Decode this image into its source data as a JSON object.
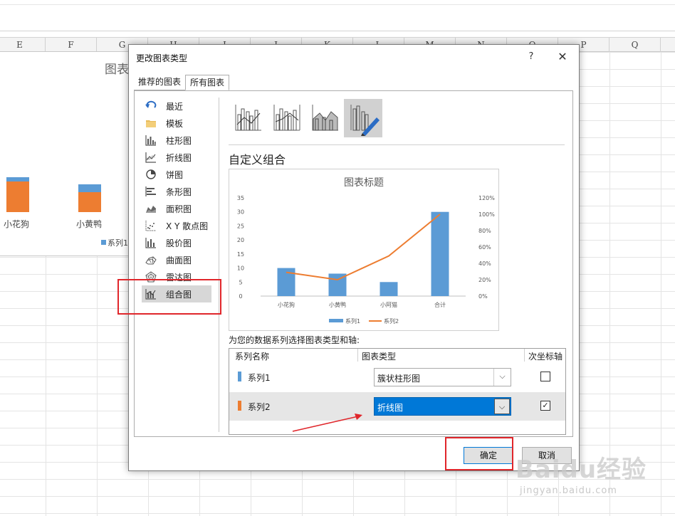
{
  "sheet": {
    "columns": [
      "E",
      "F",
      "G",
      "H",
      "I",
      "J",
      "K",
      "L",
      "M",
      "N",
      "O",
      "P",
      "Q"
    ],
    "chart": {
      "title": "图表",
      "categories": [
        "小花狗",
        "小黄鸭"
      ],
      "legend": "系列1"
    }
  },
  "dialog": {
    "title": "更改图表类型",
    "help": "?",
    "close": "✕",
    "tabs": [
      {
        "label": "推荐的图表"
      },
      {
        "label": "所有图表"
      }
    ],
    "chart_types": [
      {
        "label": "最近",
        "icon": "undo-icon"
      },
      {
        "label": "模板",
        "icon": "folder-icon"
      },
      {
        "label": "柱形图",
        "icon": "column-chart-icon"
      },
      {
        "label": "折线图",
        "icon": "line-chart-icon"
      },
      {
        "label": "饼图",
        "icon": "pie-chart-icon"
      },
      {
        "label": "条形图",
        "icon": "bar-chart-icon"
      },
      {
        "label": "面积图",
        "icon": "area-chart-icon"
      },
      {
        "label": "X Y 散点图",
        "icon": "scatter-chart-icon"
      },
      {
        "label": "股价图",
        "icon": "stock-chart-icon"
      },
      {
        "label": "曲面图",
        "icon": "surface-chart-icon"
      },
      {
        "label": "雷达图",
        "icon": "radar-chart-icon"
      },
      {
        "label": "组合图",
        "icon": "combo-chart-icon"
      }
    ],
    "selected_type": "组合图",
    "section_title": "自定义组合",
    "series_prompt": "为您的数据系列选择图表类型和轴:",
    "table": {
      "headers": [
        "系列名称",
        "图表类型",
        "次坐标轴"
      ],
      "rows": [
        {
          "name": "系列1",
          "type": "簇状柱形图",
          "secondary": false,
          "color": "#5b9bd5"
        },
        {
          "name": "系列2",
          "type": "折线图",
          "secondary": true,
          "color": "#ed7d31"
        }
      ],
      "dropdown_glyph": "⌵",
      "check_glyph": "✓"
    },
    "ok_label": "确定",
    "cancel_label": "取消"
  },
  "chart_data": {
    "type": "bar",
    "title": "图表标题",
    "categories": [
      "小花狗",
      "小黄鸭",
      "小阿猫",
      "合计"
    ],
    "series": [
      {
        "name": "系列1",
        "chart": "bar",
        "axis": "primary",
        "color": "#5b9bd5",
        "values": [
          10,
          8,
          5,
          30
        ]
      },
      {
        "name": "系列2",
        "chart": "line",
        "axis": "secondary",
        "color": "#ed7d31",
        "values": [
          0.29,
          0.2,
          0.49,
          1.0
        ]
      }
    ],
    "y_ticks": [
      0,
      5,
      10,
      15,
      20,
      25,
      30,
      35
    ],
    "y2_ticks": [
      "0%",
      "20%",
      "40%",
      "60%",
      "80%",
      "100%",
      "120%"
    ],
    "ylim": [
      0,
      35
    ],
    "y2lim": [
      0,
      1.2
    ],
    "legend": "bottom",
    "grid": false
  },
  "watermark": {
    "text": "Baidu经验",
    "url": "jingyan.baidu.com"
  }
}
